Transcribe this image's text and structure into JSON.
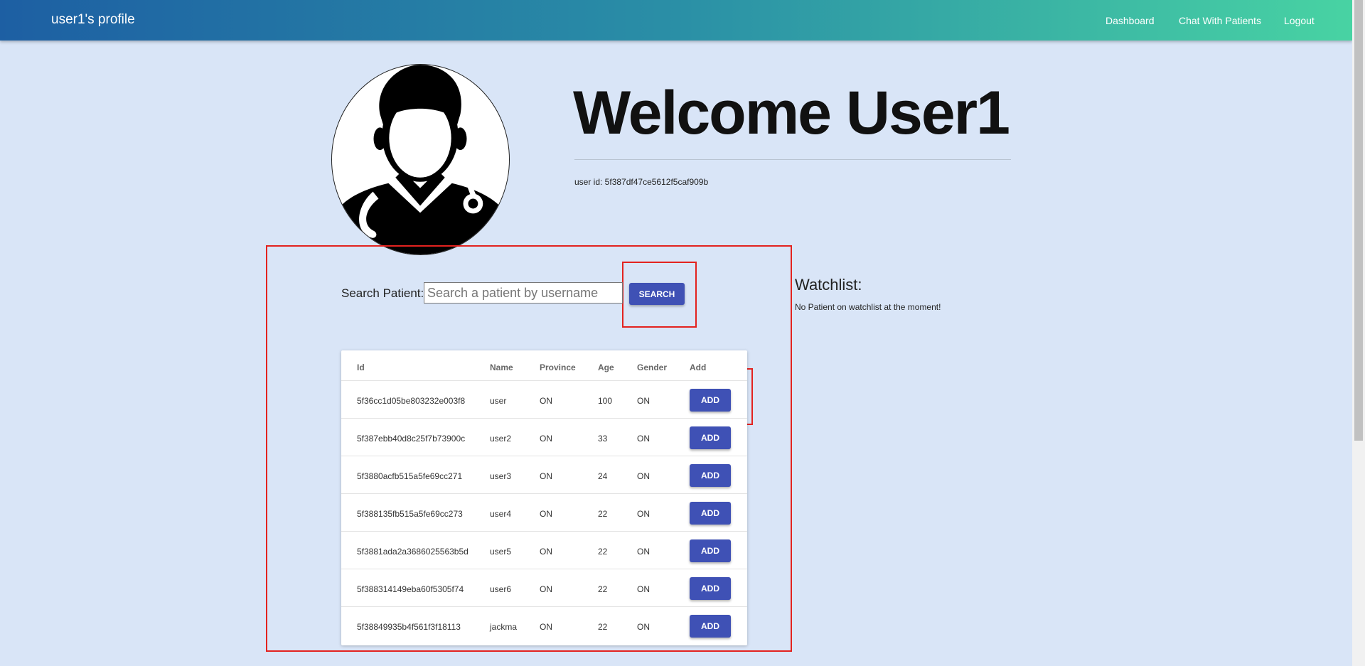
{
  "header": {
    "title": "user1's profile",
    "nav": [
      "Dashboard",
      "Chat With Patients",
      "Logout"
    ]
  },
  "profile": {
    "welcome": "Welcome User1",
    "user_id": "user id: 5f387df47ce5612f5caf909b"
  },
  "search": {
    "label": "Search Patient:",
    "placeholder": "Search a patient by username",
    "button": "SEARCH"
  },
  "watchlist": {
    "title": "Watchlist:",
    "empty_text": "No Patient on watchlist at the moment!"
  },
  "table": {
    "columns": [
      "Id",
      "Name",
      "Province",
      "Age",
      "Gender",
      "Add"
    ],
    "rows": [
      {
        "id": "5f36cc1d05be803232e003f8",
        "name": "user",
        "province": "ON",
        "age": "100",
        "gender": "ON",
        "action": "ADD"
      },
      {
        "id": "5f387ebb40d8c25f7b73900c",
        "name": "user2",
        "province": "ON",
        "age": "33",
        "gender": "ON",
        "action": "ADD"
      },
      {
        "id": "5f3880acfb515a5fe69cc271",
        "name": "user3",
        "province": "ON",
        "age": "24",
        "gender": "ON",
        "action": "ADD"
      },
      {
        "id": "5f388135fb515a5fe69cc273",
        "name": "user4",
        "province": "ON",
        "age": "22",
        "gender": "ON",
        "action": "ADD"
      },
      {
        "id": "5f3881ada2a3686025563b5d",
        "name": "user5",
        "province": "ON",
        "age": "22",
        "gender": "ON",
        "action": "ADD"
      },
      {
        "id": "5f388314149eba60f5305f74",
        "name": "user6",
        "province": "ON",
        "age": "22",
        "gender": "ON",
        "action": "ADD"
      },
      {
        "id": "5f38849935b4f561f3f18113",
        "name": "jackma",
        "province": "ON",
        "age": "22",
        "gender": "ON",
        "action": "ADD"
      }
    ]
  },
  "colors": {
    "header_gradient_start": "#1d5fa3",
    "header_gradient_end": "#48d3a3",
    "page_bg": "#d9e5f7",
    "button": "#3f51b5",
    "highlight": "#e3221f"
  },
  "icons": {
    "avatar": "doctor-avatar-icon"
  }
}
